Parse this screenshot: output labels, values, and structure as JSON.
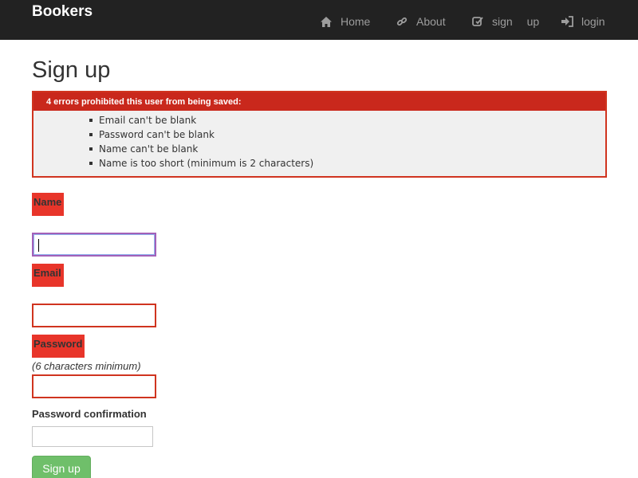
{
  "navbar": {
    "brand": "Bookers",
    "items": [
      {
        "label": "Home",
        "icon": "home-icon"
      },
      {
        "label": "About",
        "icon": "link-icon"
      },
      {
        "label": "sign up",
        "icon": "edit-icon"
      },
      {
        "label": "login",
        "icon": "login-icon"
      }
    ]
  },
  "page": {
    "title": "Sign up"
  },
  "errors": {
    "header": "4 errors prohibited this user from being saved:",
    "messages": [
      "Email can't be blank",
      "Password can't be blank",
      "Name can't be blank",
      "Name is too short (minimum is 2 characters)"
    ]
  },
  "form": {
    "name_label": "Name",
    "name_value": "",
    "email_label": "Email",
    "email_value": "",
    "password_label": "Password",
    "password_hint": "(6 characters minimum)",
    "password_value": "",
    "confirm_label": "Password confirmation",
    "confirm_value": "",
    "submit_label": "Sign up"
  },
  "colors": {
    "navbar_bg": "#222222",
    "error_red": "#c9281c",
    "label_error_bg": "#e8352a",
    "submit_green": "#6fbf6a"
  }
}
